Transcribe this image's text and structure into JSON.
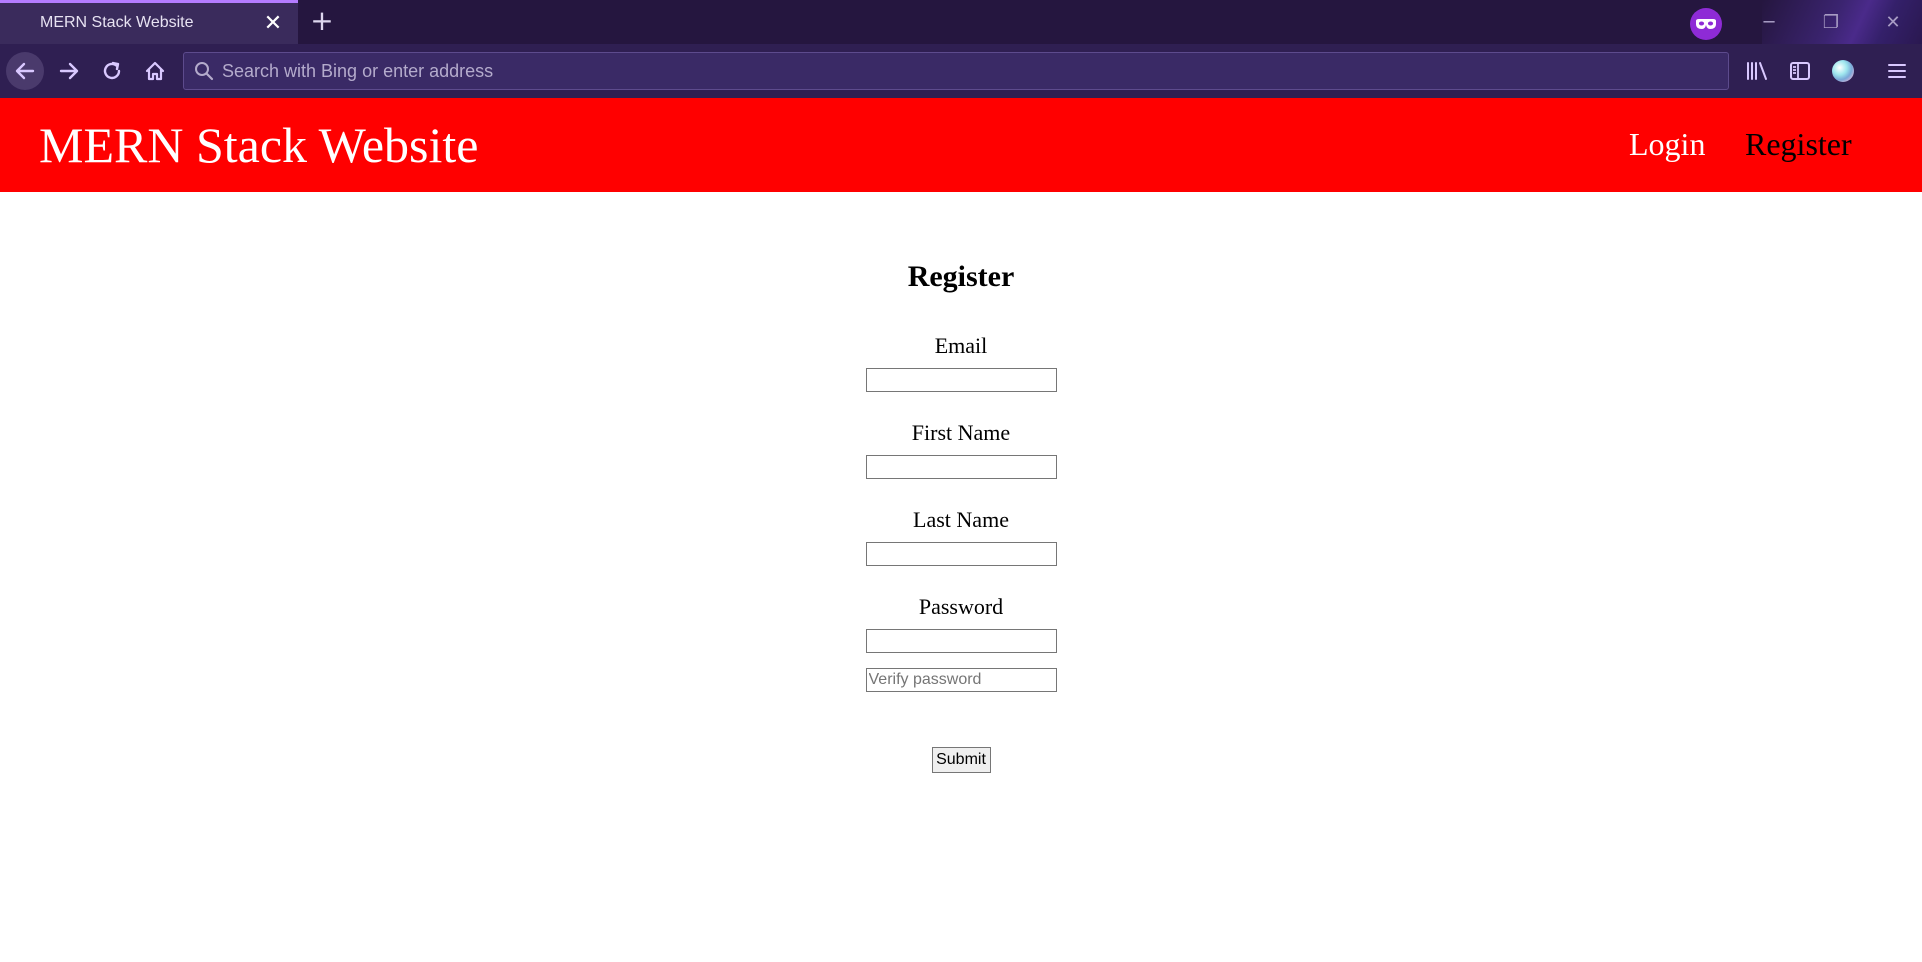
{
  "browser": {
    "tab": {
      "title": "MERN Stack Website",
      "close_glyph": "✕"
    },
    "new_tab_glyph": "+",
    "address_bar": {
      "placeholder": "Search with Bing or enter address",
      "value": ""
    },
    "colors": {
      "tabstrip": "#25163f",
      "toolbar": "#2f1f52",
      "tab_accent": "#b47cff"
    },
    "icons": {
      "back": "back-arrow-icon",
      "forward": "forward-arrow-icon",
      "reload": "reload-icon",
      "home": "home-icon",
      "search": "search-icon",
      "library": "library-icon",
      "sidebar": "sidebar-icon",
      "profile": "profile-icon",
      "menu": "hamburger-menu-icon",
      "private": "private-browsing-mask-icon"
    },
    "window_controls": {
      "minimize": "─",
      "restore": "❐",
      "close": "✕"
    }
  },
  "site": {
    "title": "MERN Stack Website",
    "header_color": "#ff0000",
    "nav": {
      "login": "Login",
      "register": "Register"
    }
  },
  "form": {
    "heading": "Register",
    "email_label": "Email",
    "first_name_label": "First Name",
    "last_name_label": "Last Name",
    "password_label": "Password",
    "verify_password_placeholder": "Verify password",
    "submit_label": "Submit"
  }
}
